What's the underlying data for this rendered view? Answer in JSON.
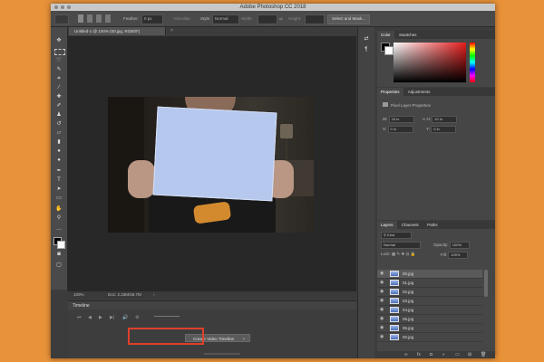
{
  "app": {
    "title": "Adobe Photoshop CC 2018"
  },
  "options_bar": {
    "feather_label": "Feather:",
    "feather_value": "0 px",
    "antialias_label": "Anti-alias",
    "style_label": "Style:",
    "style_value": "Normal",
    "width_label": "Width:",
    "height_label": "Height:",
    "select_mask_label": "Select and Mask..."
  },
  "document": {
    "tab_label": "Untitled-1 @ 100% (00.jpg, RGB/8*)",
    "close_glyph": "×"
  },
  "status": {
    "zoom": "100%",
    "doc_info": "Doc: 2.33M/48.7M"
  },
  "timeline": {
    "title": "Timeline",
    "controls": [
      "⏮",
      "◀",
      "▶",
      "▶|",
      "🔊",
      "⚙"
    ],
    "create_button_label": "Create Video Timeline",
    "dropdown_glyph": "⌄"
  },
  "color_panel": {
    "tabs": [
      "Color",
      "Swatches"
    ]
  },
  "properties_panel": {
    "tabs": [
      "Properties",
      "Adjustments"
    ],
    "heading": "Pixel Layer Properties",
    "w_label": "W:",
    "w_value": "15 in",
    "h_label": "H:",
    "h_value": "10 in",
    "x_label": "X:",
    "x_value": "0 in",
    "y_label": "Y:",
    "y_value": "0 in"
  },
  "layers_panel": {
    "tabs": [
      "Layers",
      "Channels",
      "Paths"
    ],
    "kind_label": "Kind",
    "blend_mode": "Normal",
    "opacity_label": "Opacity:",
    "opacity_value": "100%",
    "lock_label": "Lock:",
    "fill_label": "Fill:",
    "fill_value": "100%",
    "layers": [
      "00.jpg",
      "01.jpg",
      "02.jpg",
      "03.jpg",
      "04.jpg",
      "05.jpg",
      "06.jpg",
      "00.jpg"
    ],
    "selected_index": 0
  },
  "colors": {
    "accent_highlight": "#e0402a",
    "background": "#e8923a"
  }
}
